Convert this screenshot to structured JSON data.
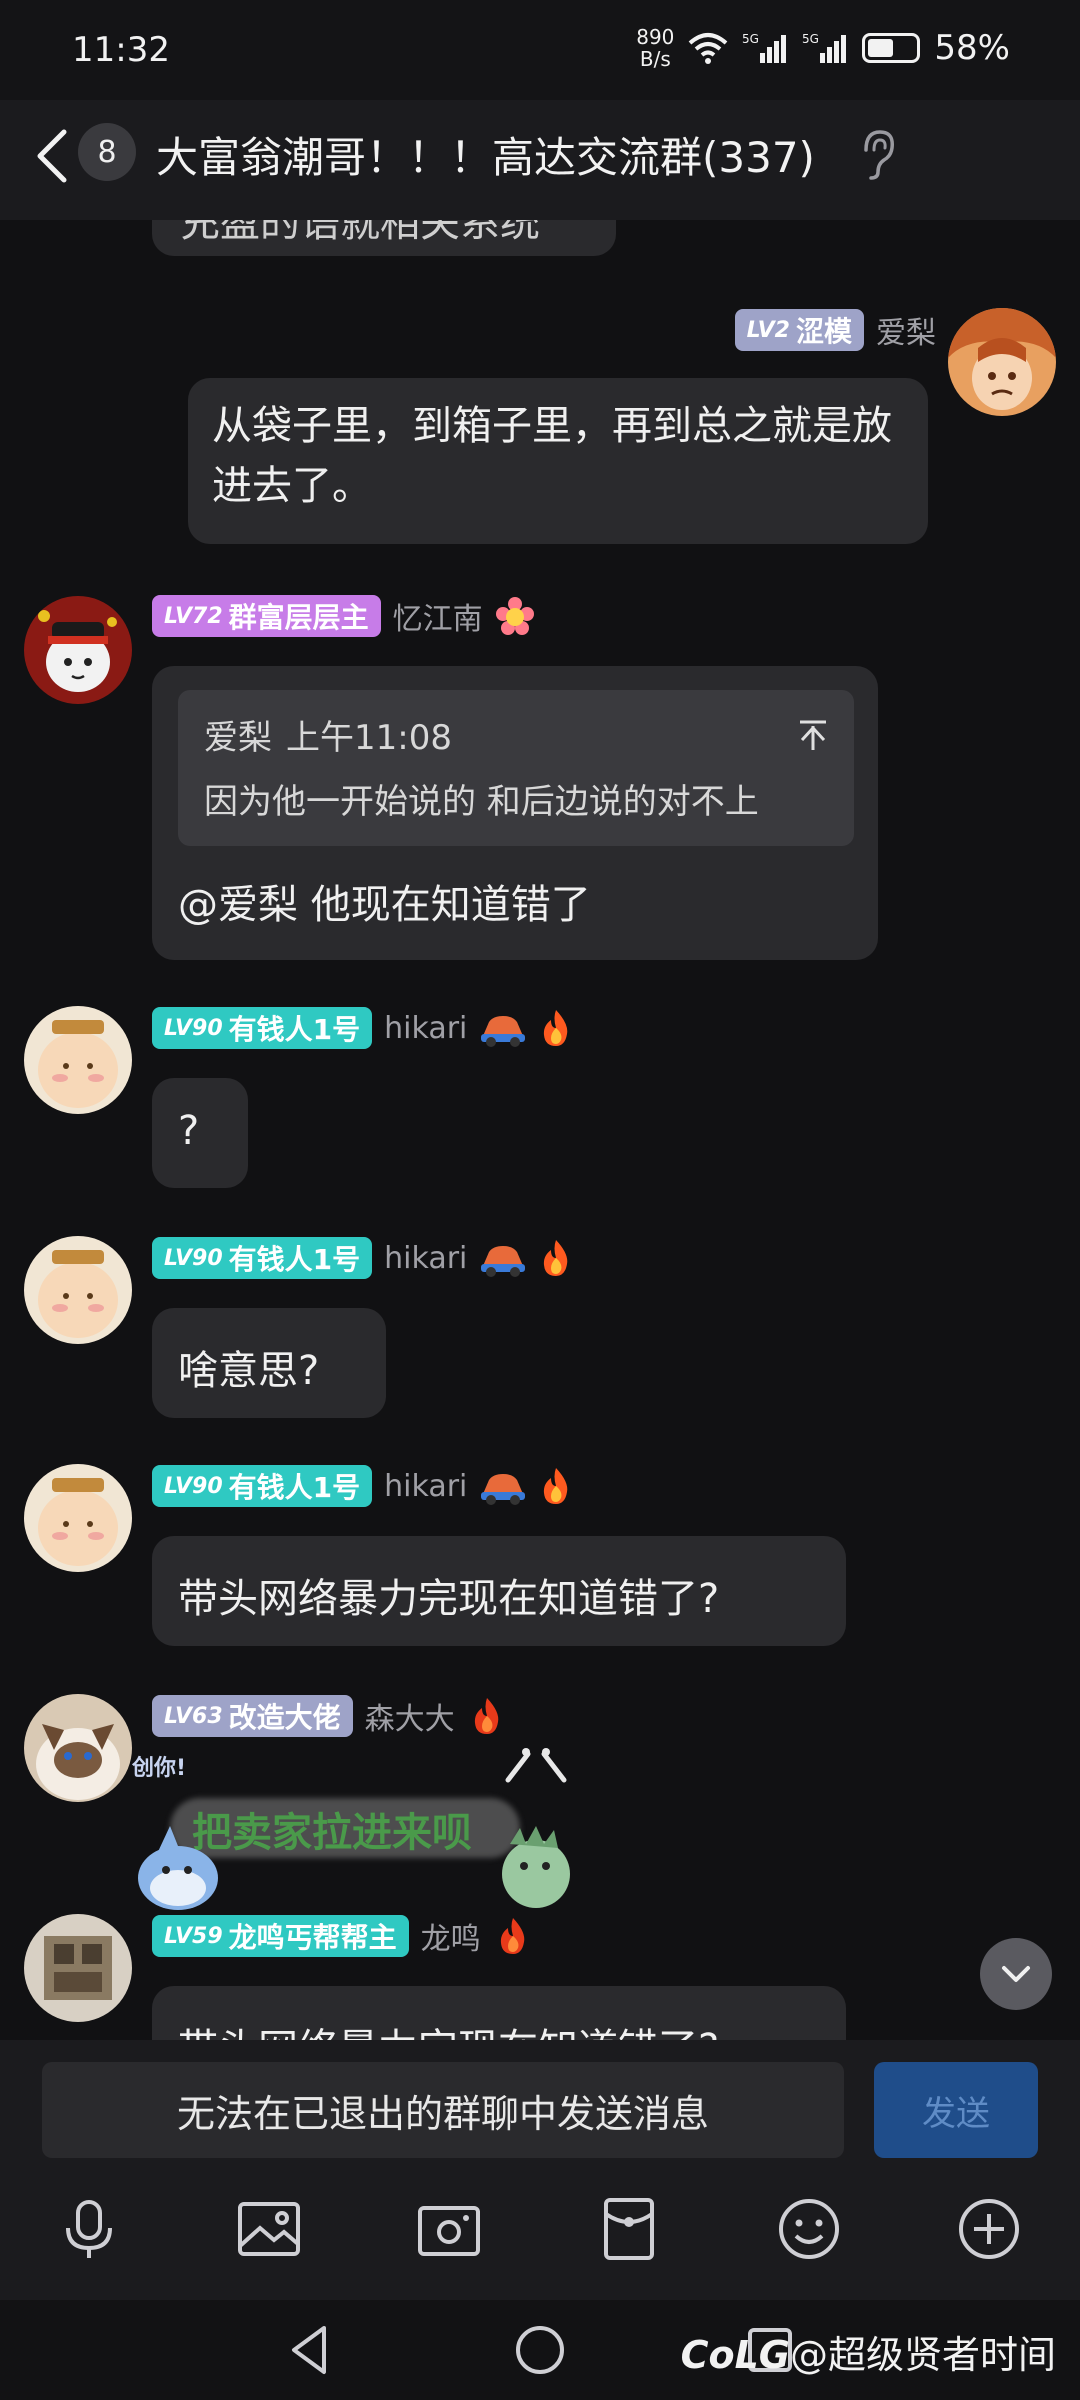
{
  "status_bar": {
    "time": "11:32",
    "net_speed_value": "890",
    "net_speed_unit": "B/s",
    "battery_percent": "58%",
    "battery_level": 0.58
  },
  "header": {
    "unread_count": "8",
    "title": "大富翁潮哥！！！高达交流群(337)"
  },
  "messages": {
    "m0": {
      "text": "充盈的语就相关系统"
    },
    "m1": {
      "level": "LV2",
      "title": "涩模",
      "name": "爱梨",
      "text": "从袋子里，到箱子里，再到总之就是放进去了。"
    },
    "m2": {
      "level": "LV72",
      "title": "群富层层主",
      "name": "忆江南",
      "quote_author": "爱梨",
      "quote_time": "上午11:08",
      "quote_text": "因为他一开始说的  和后边说的对不上",
      "text": "@爱梨 他现在知道错了"
    },
    "m3": {
      "level": "LV90",
      "title": "有钱人1号",
      "name": "hikari",
      "text": "?"
    },
    "m4": {
      "level": "LV90",
      "title": "有钱人1号",
      "name": "hikari",
      "text": "啥意思?"
    },
    "m5": {
      "level": "LV90",
      "title": "有钱人1号",
      "name": "hikari",
      "text": "带头网络暴力完现在知道错了?"
    },
    "m6": {
      "level": "LV63",
      "title": "改造大佬",
      "name": "森大大",
      "sticker_tag": "创你!",
      "sticker_text": "把卖家拉进来呗"
    },
    "m7": {
      "level": "LV59",
      "title": "龙鸣丐帮帮主",
      "name": "龙鸣",
      "text": "带头网络暴力完现在知道错了?"
    }
  },
  "input": {
    "disabled_text": "无法在已退出的群聊中发送消息",
    "send_label": "发送"
  },
  "watermark": {
    "brand": "CoLG",
    "handle": "@超级贤者时间"
  },
  "colors": {
    "bg": "#111113",
    "bubble": "#2a2a2d",
    "lv2_badge": "#9ea3c8",
    "lv72_badge": "#c77ce8",
    "lv90_badge": "#2fc9c2",
    "lv63_badge": "#9ea3c8",
    "lv59_badge": "#2fc9c2",
    "send_btn": "#1f4d8a"
  }
}
